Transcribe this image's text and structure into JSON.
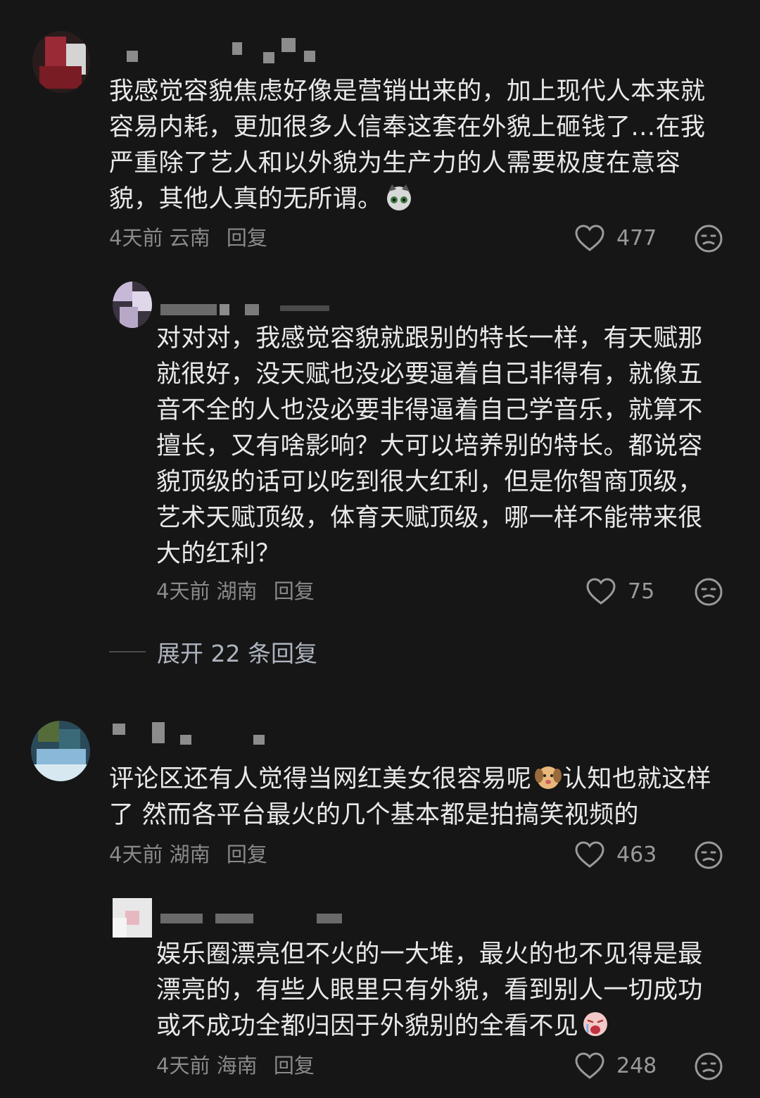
{
  "comments": [
    {
      "text": "我感觉容貌焦虑好像是营销出来的，加上现代人本来就容易内耗，更加很多人信奉这套在外貌上砸钱了…在我严重除了艺人和以外貌为生产力的人需要极度在意容貌，其他人真的无所谓。",
      "emoji": "cat-emoji",
      "time": "4天前",
      "location": "云南",
      "reply_label": "回复",
      "likes": "477",
      "replies": [
        {
          "text": "对对对，我感觉容貌就跟别的特长一样，有天赋那就很好，没天赋也没必要逼着自己非得有，就像五音不全的人也没必要非得逼着自己学音乐，就算不擅长，又有啥影响？大可以培养别的特长。都说容貌顶级的话可以吃到很大红利，但是你智商顶级，艺术天赋顶级，体育天赋顶级，哪一样不能带来很大的红利？",
          "time": "4天前",
          "location": "湖南",
          "reply_label": "回复",
          "likes": "75"
        }
      ],
      "expand_label": "展开 22 条回复"
    },
    {
      "text_before_emoji": "评论区还有人觉得当网红美女很容易呢",
      "emoji": "dog-emoji",
      "text_after_emoji": "认知也就这样了 然而各平台最火的几个基本都是拍搞笑视频的",
      "time": "4天前",
      "location": "湖南",
      "reply_label": "回复",
      "likes": "463",
      "replies": [
        {
          "text": "娱乐圈漂亮但不火的一大堆，最火的也不见得是最漂亮的，有些人眼里只有外貌，看到别人一切成功或不成功全都归因于外貌别的全看不见",
          "emoji": "crying-face-emoji",
          "time": "4天前",
          "location": "海南",
          "reply_label": "回复",
          "likes": "248"
        }
      ]
    }
  ],
  "colors": {
    "background": "#161616",
    "text": "#e9e9e9",
    "meta": "#8a8a8a",
    "expand": "#aeb4bf"
  }
}
